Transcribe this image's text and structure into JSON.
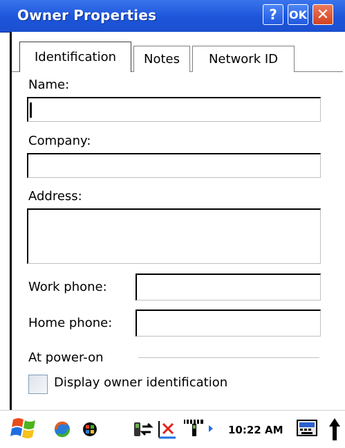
{
  "window": {
    "title": "Owner Properties",
    "help_label": "?",
    "ok_label": "OK",
    "close_label": "✕"
  },
  "tabs": [
    {
      "label": "Identification",
      "active": true
    },
    {
      "label": "Notes",
      "active": false
    },
    {
      "label": "Network ID",
      "active": false
    }
  ],
  "form": {
    "name_label": "Name:",
    "name_value": "",
    "company_label": "Company:",
    "company_value": "",
    "address_label": "Address:",
    "address_value": "",
    "work_phone_label": "Work phone:",
    "work_phone_value": "",
    "home_phone_label": "Home phone:",
    "home_phone_value": "",
    "group_label": "At power-on",
    "display_owner_label": "Display owner identification",
    "display_owner_checked": false
  },
  "taskbar": {
    "clock": "10:22 AM",
    "icons": [
      "windows-start-icon",
      "sync-icon",
      "color-wheel-icon",
      "connectivity-icon",
      "no-signal-icon",
      "antenna-icon",
      "keyboard-icon",
      "up-arrow-icon"
    ]
  }
}
